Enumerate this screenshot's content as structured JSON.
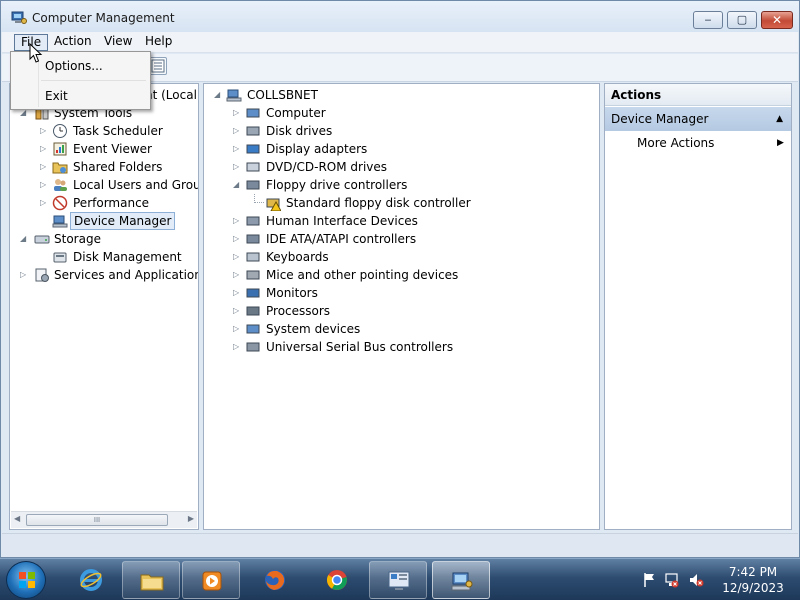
{
  "window": {
    "title": "Computer Management",
    "min_glyph": "‒",
    "max_glyph": "▢",
    "close_glyph": "✕"
  },
  "menubar": {
    "items": [
      {
        "label": "File"
      },
      {
        "label": "Action"
      },
      {
        "label": "View"
      },
      {
        "label": "Help"
      }
    ]
  },
  "file_menu": {
    "items": [
      {
        "label": "Options..."
      },
      {
        "label": "Exit"
      }
    ]
  },
  "left_tree": {
    "root_partial": "nt (Local",
    "system_tools_partial": "System Tools",
    "items": [
      {
        "label": "Task Scheduler"
      },
      {
        "label": "Event Viewer"
      },
      {
        "label": "Shared Folders"
      },
      {
        "label": "Local Users and Groups"
      },
      {
        "label": "Performance"
      },
      {
        "label": "Device Manager",
        "selected": true
      },
      {
        "label": "Storage"
      },
      {
        "label": "Disk Management"
      },
      {
        "label": "Services and Applications"
      }
    ],
    "scroll_grip": "III"
  },
  "device_tree": {
    "root": "COLLSBNET",
    "categories": [
      {
        "label": "Computer"
      },
      {
        "label": "Disk drives"
      },
      {
        "label": "Display adapters"
      },
      {
        "label": "DVD/CD-ROM drives"
      },
      {
        "label": "Floppy drive controllers",
        "expanded": true
      },
      {
        "label": "Standard floppy disk controller",
        "child": true,
        "warning": true
      },
      {
        "label": "Human Interface Devices"
      },
      {
        "label": "IDE ATA/ATAPI controllers"
      },
      {
        "label": "Keyboards"
      },
      {
        "label": "Mice and other pointing devices"
      },
      {
        "label": "Monitors"
      },
      {
        "label": "Processors"
      },
      {
        "label": "System devices"
      },
      {
        "label": "Universal Serial Bus controllers"
      }
    ]
  },
  "actions_pane": {
    "header": "Actions",
    "section": "Device Manager",
    "item": "More Actions",
    "section_glyph": "▲",
    "item_glyph": "▶"
  },
  "taskbar": {
    "apps": [
      {
        "name": "windows-explorer-icon"
      },
      {
        "name": "internet-explorer-icon"
      },
      {
        "name": "file-explorer-icon"
      },
      {
        "name": "media-player-icon"
      },
      {
        "name": "firefox-icon"
      },
      {
        "name": "chrome-icon"
      },
      {
        "name": "control-panel-icon"
      },
      {
        "name": "computer-management-icon"
      }
    ],
    "time": "7:42 PM",
    "date": "12/9/2023"
  },
  "colors": {
    "selection": "#e1ecf8",
    "actions_section": "#b4c9e2",
    "taskbar": "#2d4c70"
  }
}
